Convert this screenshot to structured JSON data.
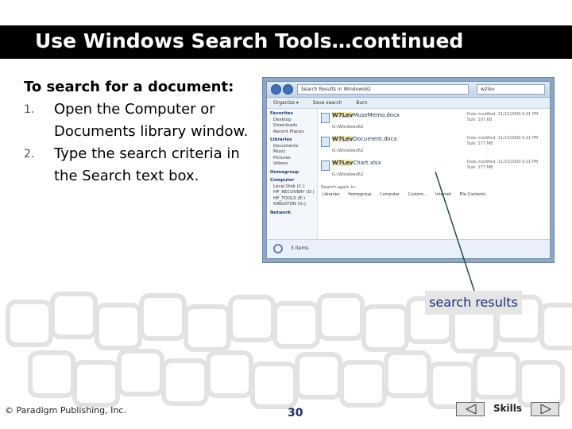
{
  "slide": {
    "title": "Use Windows Search Tools…continued",
    "heading": "To search for a document:",
    "steps": [
      {
        "number": "1.",
        "text": "Open the Computer or Documents library window."
      },
      {
        "number": "2.",
        "text": "Type the search criteria in the Search text box."
      }
    ],
    "callout": "search results",
    "footer": "© Paradigm Publishing, Inc.",
    "page_number": "30",
    "skills_label": "Skills"
  },
  "screenshot": {
    "address": "Search Results in Windows62",
    "search_value": "w2lev",
    "toolbar": [
      "Organize ▾",
      "Save search",
      "Burn"
    ],
    "nav": [
      {
        "label": "Favorites",
        "group": true
      },
      {
        "label": "Desktop",
        "group": false
      },
      {
        "label": "Downloads",
        "group": false
      },
      {
        "label": "Recent Places",
        "group": false
      },
      {
        "label": "Libraries",
        "group": true
      },
      {
        "label": "Documents",
        "group": false
      },
      {
        "label": "Music",
        "group": false
      },
      {
        "label": "Pictures",
        "group": false
      },
      {
        "label": "Videos",
        "group": false
      },
      {
        "label": "Homegroup",
        "group": true
      },
      {
        "label": "Computer",
        "group": true
      },
      {
        "label": "Local Disk (C:)",
        "group": false
      },
      {
        "label": "HP_RECOVERY (D:)",
        "group": false
      },
      {
        "label": "HP_TOOLS (E:)",
        "group": false
      },
      {
        "label": "KINGSTON (G:)",
        "group": false
      },
      {
        "label": "Network",
        "group": true
      }
    ],
    "results": [
      {
        "highlight": "W7Lev",
        "rest": "MuseMemo.docx",
        "path": "G:\\Windows62",
        "modified": "Date modified: 11/15/2009 9:21 PM",
        "size": "Size: 107 KB"
      },
      {
        "highlight": "W7Lev",
        "rest": "Document.docx",
        "path": "G:\\Windows62",
        "modified": "Date modified: 11/15/2009 9:21 PM",
        "size": "Size: 177 MB"
      },
      {
        "highlight": "W7Lev",
        "rest": "Chart.xlsx",
        "path": "G:\\Windows62",
        "modified": "Date modified: 11/15/2009 9:21 PM",
        "size": "Size: 177 MB"
      }
    ],
    "search_again_label": "Search again in:",
    "search_again_options": [
      "Libraries",
      "Homegroup",
      "Computer",
      "Custom...",
      "Internet",
      "File Contents"
    ],
    "status": "3 items"
  },
  "colors": {
    "title_bg": "#000000",
    "title_text": "#ffffff",
    "callout_bg": "#e5e5e5",
    "callout_text": "#1b2f78",
    "callout_line": "#1f4e50"
  }
}
